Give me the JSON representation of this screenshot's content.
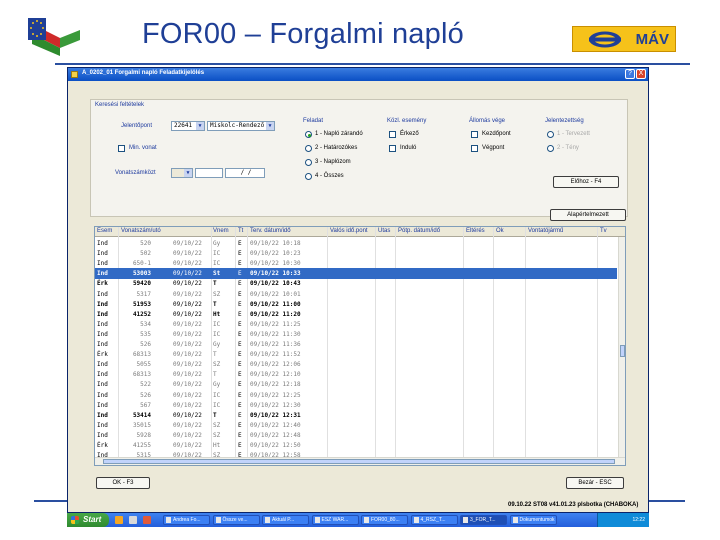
{
  "slide": {
    "title": "FOR00 – Forgalmi napló",
    "mav_logo_text": "MÁV",
    "eu_logo": "eu-hungary-flag-logo",
    "colors": {
      "title": "#1f3f96",
      "mav_yellow": "#f6c21a",
      "rule": "#2a4fa0"
    }
  },
  "window": {
    "title": "A_0202_01  Forgalmi napló  Feladatkijelölés",
    "help_label": "?",
    "close_label": "X"
  },
  "search": {
    "caption": "Keresési feltételek",
    "station_label": "Jelentőpont",
    "station_code": "22641",
    "station_name": "Miskolc-Rendező",
    "min_checkbox_label": "Min. vonat",
    "train_number_label": "Vonatszámközt",
    "train_value": "/ /",
    "feladat": {
      "caption": "Feladat",
      "options": [
        "1 - Napló zárandó",
        "2 - Határozókes",
        "3 - Naplózom",
        "4 - Összes"
      ],
      "selected": 0
    },
    "kozlekedes": {
      "caption": "Közl. esemény",
      "options": [
        "Érkező",
        "Induló"
      ]
    },
    "allomas": {
      "caption": "Állomás vége",
      "options": [
        "Kezdőpont",
        "Végpont"
      ]
    },
    "jelentes": {
      "caption": "Jelentezettség",
      "options": [
        "1 - Tervezett",
        "2 - Tény"
      ]
    },
    "efelkez_button": "Előhoz - F4",
    "alapertelmezett_button": "Alapértelmezett"
  },
  "grid": {
    "columns": [
      "Esem",
      "Vonatszám/utó",
      "Vnem",
      "Tt",
      "Terv. dátum/idő",
      "Valós idő.pont",
      "Utas",
      "Pótp. dátum/idő",
      "Eltérés",
      "Ok",
      "Vontatójármű",
      "Tv"
    ],
    "rows": [
      {
        "esem": "Ind",
        "vonat": "520",
        "datum": "09/10/22",
        "vnem": "Gy",
        "tt": "E",
        "terv": "09/10/22 10:18",
        "bold": false,
        "selected": false
      },
      {
        "esem": "Ind",
        "vonat": "502",
        "datum": "09/10/22",
        "vnem": "IC",
        "tt": "E",
        "terv": "09/10/22 10:23",
        "bold": false,
        "selected": false
      },
      {
        "esem": "Ind",
        "vonat": "650-1",
        "datum": "09/10/22",
        "vnem": "IC",
        "tt": "E",
        "terv": "09/10/22 10:30",
        "bold": false,
        "selected": false
      },
      {
        "esem": "Ind",
        "vonat": "53003",
        "datum": "09/10/22",
        "vnem": "St",
        "tt": "E",
        "terv": "09/10/22 10:33",
        "bold": true,
        "selected": true
      },
      {
        "esem": "Érk",
        "vonat": "59420",
        "datum": "09/10/22",
        "vnem": "T",
        "tt": "E",
        "terv": "09/10/22 10:43",
        "bold": true,
        "selected": false
      },
      {
        "esem": "Ind",
        "vonat": "5317",
        "datum": "09/10/22",
        "vnem": "SZ",
        "tt": "E",
        "terv": "09/10/22 10:01",
        "bold": false,
        "selected": false
      },
      {
        "esem": "Ind",
        "vonat": "51953",
        "datum": "09/10/22",
        "vnem": "T",
        "tt": "E",
        "terv": "09/10/22 11:00",
        "bold": true,
        "selected": false
      },
      {
        "esem": "Ind",
        "vonat": "41252",
        "datum": "09/10/22",
        "vnem": "Ht",
        "tt": "E",
        "terv": "09/10/22 11:20",
        "bold": true,
        "selected": false
      },
      {
        "esem": "Ind",
        "vonat": "534",
        "datum": "09/10/22",
        "vnem": "IC",
        "tt": "E",
        "terv": "09/10/22 11:25",
        "bold": false,
        "selected": false
      },
      {
        "esem": "Ind",
        "vonat": "535",
        "datum": "09/10/22",
        "vnem": "IC",
        "tt": "E",
        "terv": "09/10/22 11:30",
        "bold": false,
        "selected": false
      },
      {
        "esem": "Ind",
        "vonat": "526",
        "datum": "09/10/22",
        "vnem": "Gy",
        "tt": "E",
        "terv": "09/10/22 11:36",
        "bold": false,
        "selected": false
      },
      {
        "esem": "Érk",
        "vonat": "68313",
        "datum": "09/10/22",
        "vnem": "T",
        "tt": "E",
        "terv": "09/10/22 11:52",
        "bold": false,
        "selected": false
      },
      {
        "esem": "Ind",
        "vonat": "5055",
        "datum": "09/10/22",
        "vnem": "SZ",
        "tt": "E",
        "terv": "09/10/22 12:06",
        "bold": false,
        "selected": false
      },
      {
        "esem": "Ind",
        "vonat": "68313",
        "datum": "09/10/22",
        "vnem": "T",
        "tt": "E",
        "terv": "09/10/22 12:10",
        "bold": false,
        "selected": false
      },
      {
        "esem": "Ind",
        "vonat": "522",
        "datum": "09/10/22",
        "vnem": "Gy",
        "tt": "E",
        "terv": "09/10/22 12:18",
        "bold": false,
        "selected": false
      },
      {
        "esem": "Ind",
        "vonat": "526",
        "datum": "09/10/22",
        "vnem": "IC",
        "tt": "E",
        "terv": "09/10/22 12:25",
        "bold": false,
        "selected": false
      },
      {
        "esem": "Ind",
        "vonat": "567",
        "datum": "09/10/22",
        "vnem": "IC",
        "tt": "E",
        "terv": "09/10/22 12:30",
        "bold": false,
        "selected": false
      },
      {
        "esem": "Ind",
        "vonat": "53414",
        "datum": "09/10/22",
        "vnem": "T",
        "tt": "E",
        "terv": "09/10/22 12:31",
        "bold": true,
        "selected": false
      },
      {
        "esem": "Ind",
        "vonat": "35015",
        "datum": "09/10/22",
        "vnem": "SZ",
        "tt": "E",
        "terv": "09/10/22 12:40",
        "bold": false,
        "selected": false
      },
      {
        "esem": "Ind",
        "vonat": "5928",
        "datum": "09/10/22",
        "vnem": "SZ",
        "tt": "E",
        "terv": "09/10/22 12:48",
        "bold": false,
        "selected": false
      },
      {
        "esem": "Érk",
        "vonat": "41255",
        "datum": "09/10/22",
        "vnem": "Ht",
        "tt": "E",
        "terv": "09/10/22 12:50",
        "bold": false,
        "selected": false
      },
      {
        "esem": "Ind",
        "vonat": "5315",
        "datum": "09/10/22",
        "vnem": "SZ",
        "tt": "E",
        "terv": "09/10/22 12:58",
        "bold": false,
        "selected": false
      }
    ]
  },
  "footer": {
    "ok_button": "OK - F3",
    "close_button": "Bezár - ESC",
    "status_text": "09.10.22 ST08 v41.01.23 plsbotka (CHABOKA)"
  },
  "taskbar": {
    "start_label": "Start",
    "tasks": [
      "Andrea Fo...",
      "Össze ve...",
      "Aktuál P...",
      "ESZ WAR...",
      "FOR00_80...",
      "4_RSZ_T...",
      "3_FOR_T...",
      "Dokumentumok"
    ],
    "active_task": 6,
    "clock": "12:22"
  }
}
